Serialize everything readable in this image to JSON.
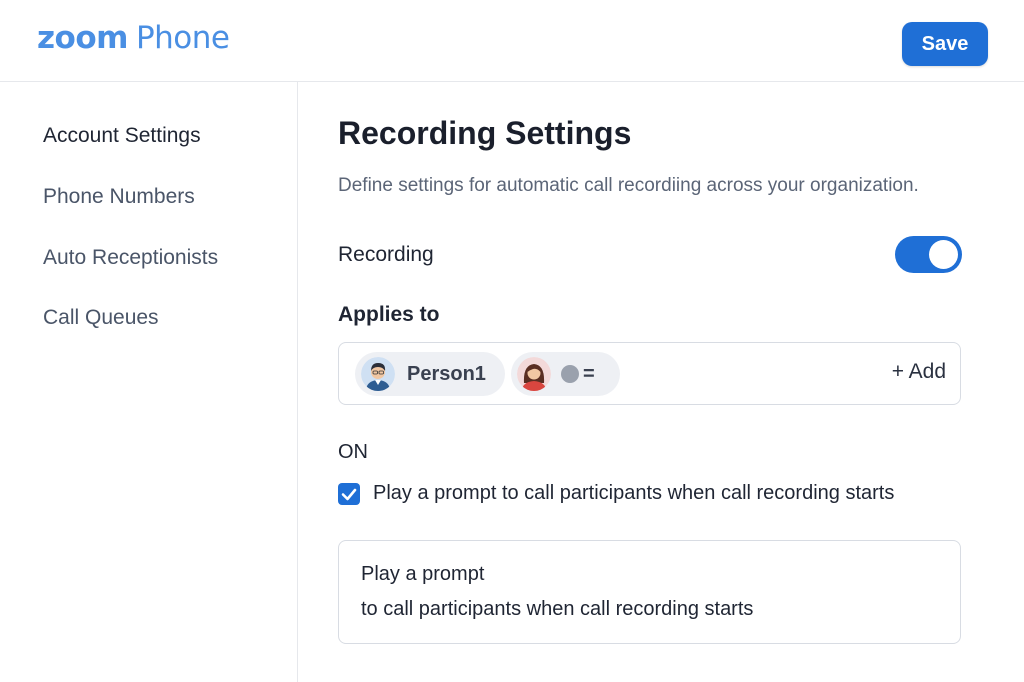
{
  "header": {
    "logo_zoom": "zoom",
    "logo_phone": "Phone",
    "save_label": "Save"
  },
  "sidebar": {
    "items": [
      {
        "label": "Account Settings",
        "active": true
      },
      {
        "label": "Phone Numbers",
        "active": false
      },
      {
        "label": "Auto Receptionists",
        "active": false
      },
      {
        "label": "Call Queues",
        "active": false
      }
    ]
  },
  "main": {
    "title": "Recording Settings",
    "description": "Define settings for automatic call recordiing across your organization.",
    "recording": {
      "label": "Recording",
      "enabled": true
    },
    "applies_to": {
      "label": "Applies to",
      "chips": [
        {
          "name": "Person1",
          "avatar": "male-avatar-icon"
        },
        {
          "name": "",
          "avatar": "female-avatar-icon",
          "extra": "="
        }
      ],
      "add_label": "+ Add"
    },
    "on_label": "ON",
    "prompt_checkbox": {
      "checked": true,
      "label": "Play a prompt to call participants when call recording starts"
    },
    "prompt_text": {
      "line1": "Play a prompt",
      "line2": "to call participants when call recording starts"
    }
  },
  "colors": {
    "accent": "#1f6fd6",
    "logo": "#4a8fe3"
  }
}
